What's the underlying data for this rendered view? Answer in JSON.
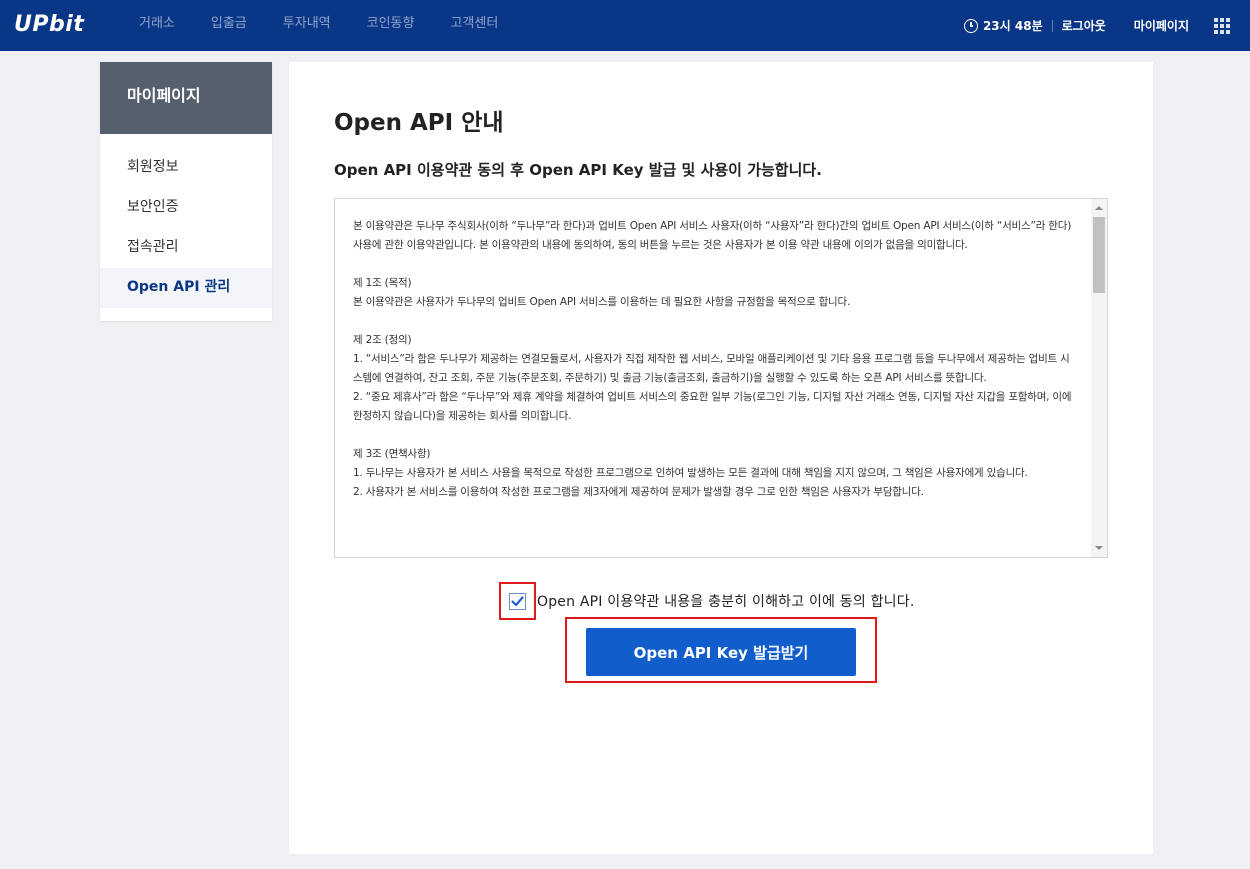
{
  "header": {
    "logo": "UPbit",
    "nav": [
      "거래소",
      "입출금",
      "투자내역",
      "코인동향",
      "고객센터"
    ],
    "time": "23시 48분",
    "logout": "로그아웃",
    "mypage": "마이페이지",
    "menu_icon": "grid-menu-icon",
    "clock_icon": "clock-icon",
    "bg_color": "#093687"
  },
  "sidebar": {
    "title": "마이페이지",
    "items": [
      {
        "label": "회원정보",
        "active": false
      },
      {
        "label": "보안인증",
        "active": false
      },
      {
        "label": "접속관리",
        "active": false
      },
      {
        "label": "Open API 관리",
        "active": true
      }
    ]
  },
  "main": {
    "title": "Open API 안내",
    "subtitle": "Open API 이용약관 동의 후 Open API Key 발급 및 사용이 가능합니다.",
    "terms": [
      "본 이용약관은 두나무 주식회사(이하 “두나무”라 한다)과 업비트 Open API 서비스 사용자(이하 “사용자”라 한다)간의 업비트 Open API 서비스(이하 “서비스”라 한다) 사용에 관한 이용약관입니다. 본 이용약관의 내용에 동의하여, 동의 버튼을 누르는 것은 사용자가 본 이용 약관 내용에 이의가 없음을 의미합니다.",
      "",
      "제 1조 (목적)",
      "본 이용약관은 사용자가 두나무의 업비트 Open API 서비스를 이용하는 데 필요한 사항을 규정함을 목적으로 합니다.",
      "",
      "제 2조 (정의)",
      "1. “서비스”라 함은 두나무가 제공하는 연결모듈로서, 사용자가 직접 제작한 웹 서비스, 모바일 애플리케이션 및 기타 응용 프로그램 등을 두나무에서 제공하는 업비트 시스템에 연결하여, 잔고 조회, 주문 기능(주문조회, 주문하기) 및 출금 기능(출금조회, 출금하기)을 실행할 수 있도록 하는 오픈 API 서비스를 뜻합니다.",
      "2. “중요 제휴사”라 함은 “두나무”와 제휴 계약을 체결하여 업비트 서비스의 중요한 일부 기능(로그인 기능, 디지털 자산 거래소 연동, 디지털 자산 지갑을 포함하며, 이에 한정하지 않습니다)을 제공하는 회사를 의미합니다.",
      "",
      "제 3조 (면책사항)",
      "1. 두나무는 사용자가 본 서비스 사용을 목적으로 작성한 프로그램으로 인하여 발생하는 모든 결과에 대해 책임을 지지 않으며, 그 책임은 사용자에게 있습니다.",
      "2. 사용자가 본 서비스를 이용하여 작성한 프로그램을 제3자에게 제공하여 문제가 발생할 경우 그로 인한 책임은 사용자가 부담합니다."
    ],
    "agree_label": "Open API 이용약관 내용을 충분히 이해하고 이에 동의 합니다.",
    "agree_checked": true,
    "issue_button": "Open API Key 발급받기",
    "button_color": "#115dcb"
  }
}
